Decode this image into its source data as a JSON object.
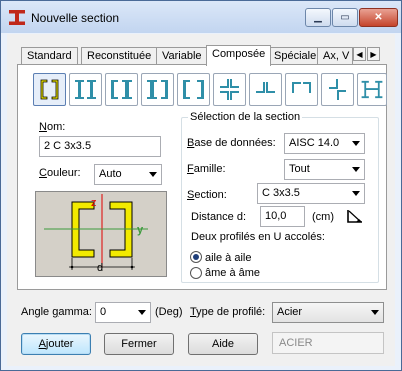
{
  "window": {
    "title": "Nouvelle section"
  },
  "tabs": [
    "Standard",
    "Reconstituée",
    "Variable",
    "Composée",
    "Spéciale",
    "Ax, V"
  ],
  "active_tab": "Composée",
  "shape_buttons": [
    "double-channel-back-to-back-icon",
    "double-i-beam-icon",
    "channel-i-combo-icon",
    "i-channel-combo-icon",
    "double-channel-face-to-face-icon",
    "cross-angles-icon",
    "double-angle-t-icon",
    "angle-box-icon",
    "angle-z-icon",
    "built-up-h-icon"
  ],
  "nom": {
    "label": "Nom:",
    "value": "2 C 3x3.5"
  },
  "couleur": {
    "label": "Couleur:",
    "value": "Auto"
  },
  "selection": {
    "title": "Sélection de la section",
    "base_label": "Base de données:",
    "base_value": "AISC 14.0",
    "famille_label": "Famille:",
    "famille_value": "Tout",
    "section_label": "Section:",
    "section_value": "C 3x3.5",
    "distance_label": "Distance d:",
    "distance_value": "10,0",
    "distance_unit": "(cm)",
    "deux_label": "Deux profilés en U accolés:",
    "option1": "aile à aile",
    "option2": "âme à âme",
    "selected_option": "aile à aile"
  },
  "preview": {
    "z_label": "z",
    "y_label": "y",
    "d_label": "d"
  },
  "angle": {
    "label": "Angle gamma:",
    "value": "0",
    "unit": "(Deg)"
  },
  "type_profile": {
    "label": "Type de profilé:",
    "value": "Acier"
  },
  "buttons": {
    "add": "Ajouter",
    "close": "Fermer",
    "help": "Aide"
  },
  "material_display": "ACIER",
  "colors": {
    "shape_yellow": "#f2ea00",
    "axis_red": "#e00000",
    "axis_green": "#3c9a3c",
    "title_icon": "#c0281a"
  }
}
